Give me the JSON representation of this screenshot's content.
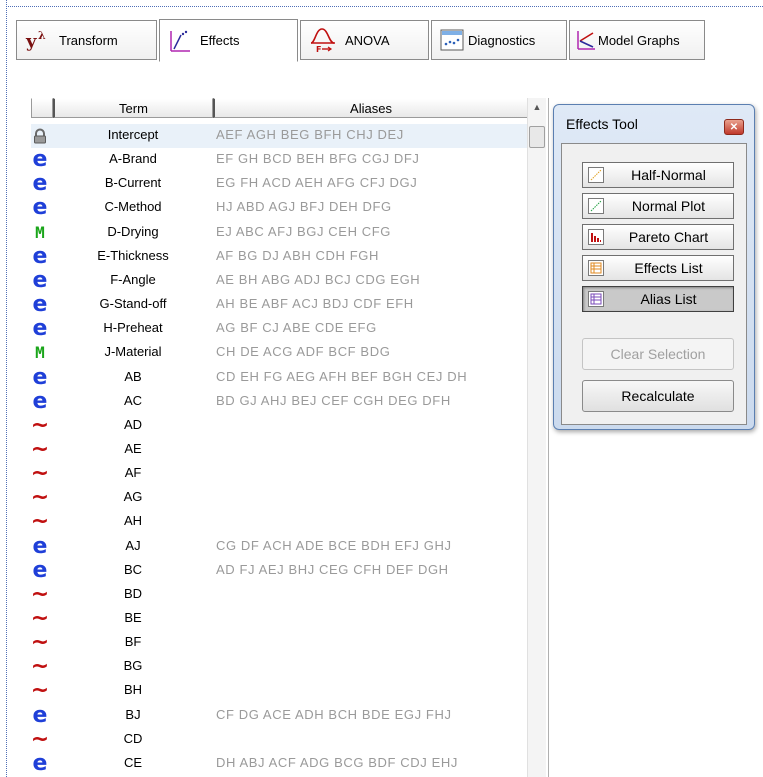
{
  "tabs": [
    {
      "id": "transform",
      "label": "Transform",
      "icon": "transform-lambda-icon",
      "active": false
    },
    {
      "id": "effects",
      "label": "Effects",
      "icon": "effects-icon",
      "active": true
    },
    {
      "id": "anova",
      "label": "ANOVA",
      "icon": "anova-icon",
      "active": false
    },
    {
      "id": "diagnostics",
      "label": "Diagnostics",
      "icon": "diagnostics-icon",
      "active": false
    },
    {
      "id": "model_graphs",
      "label": "Model Graphs",
      "icon": "model-graphs-icon",
      "active": false
    }
  ],
  "table": {
    "headers": {
      "term": "Term",
      "aliases": "Aliases"
    },
    "rows": [
      {
        "icon": "lock",
        "term": "Intercept",
        "aliases": "AEF AGH BEG BFH CHJ DEJ"
      },
      {
        "icon": "e",
        "term": "A-Brand",
        "aliases": "EF GH BCD BEH BFG CGJ DFJ"
      },
      {
        "icon": "e",
        "term": "B-Current",
        "aliases": "EG FH ACD AEH AFG CFJ DGJ"
      },
      {
        "icon": "e",
        "term": "C-Method",
        "aliases": "HJ ABD AGJ BFJ DEH DFG"
      },
      {
        "icon": "m",
        "term": "D-Drying",
        "aliases": "EJ ABC AFJ BGJ CEH CFG"
      },
      {
        "icon": "e",
        "term": "E-Thickness",
        "aliases": "AF BG DJ ABH CDH FGH"
      },
      {
        "icon": "e",
        "term": "F-Angle",
        "aliases": "AE BH ABG ADJ BCJ CDG EGH"
      },
      {
        "icon": "e",
        "term": "G-Stand-off",
        "aliases": "AH BE ABF ACJ BDJ CDF EFH"
      },
      {
        "icon": "e",
        "term": "H-Preheat",
        "aliases": "AG BF CJ ABE CDE EFG"
      },
      {
        "icon": "m",
        "term": "J-Material",
        "aliases": "CH DE ACG ADF BCF BDG"
      },
      {
        "icon": "e",
        "term": "AB",
        "aliases": "CD EH FG AEG AFH BEF BGH CEJ DH"
      },
      {
        "icon": "e",
        "term": "AC",
        "aliases": "BD GJ AHJ BEJ CEF CGH DEG DFH"
      },
      {
        "icon": "tilde",
        "term": "AD",
        "aliases": ""
      },
      {
        "icon": "tilde",
        "term": "AE",
        "aliases": ""
      },
      {
        "icon": "tilde",
        "term": "AF",
        "aliases": ""
      },
      {
        "icon": "tilde",
        "term": "AG",
        "aliases": ""
      },
      {
        "icon": "tilde",
        "term": "AH",
        "aliases": ""
      },
      {
        "icon": "e",
        "term": "AJ",
        "aliases": "CG DF ACH ADE BCE BDH EFJ GHJ"
      },
      {
        "icon": "e",
        "term": "BC",
        "aliases": "AD FJ AEJ BHJ CEG CFH DEF DGH"
      },
      {
        "icon": "tilde",
        "term": "BD",
        "aliases": ""
      },
      {
        "icon": "tilde",
        "term": "BE",
        "aliases": ""
      },
      {
        "icon": "tilde",
        "term": "BF",
        "aliases": ""
      },
      {
        "icon": "tilde",
        "term": "BG",
        "aliases": ""
      },
      {
        "icon": "tilde",
        "term": "BH",
        "aliases": ""
      },
      {
        "icon": "e",
        "term": "BJ",
        "aliases": "CF DG ACE ADH BCH BDE EGJ FHJ"
      },
      {
        "icon": "tilde",
        "term": "CD",
        "aliases": ""
      },
      {
        "icon": "e",
        "term": "CE",
        "aliases": "DH ABJ ACF ADG BCG BDF CDJ EHJ"
      }
    ]
  },
  "effects_tool": {
    "title": "Effects Tool",
    "plot_buttons": [
      {
        "label": "Half-Normal",
        "icon": "half-normal-icon",
        "pressed": false
      },
      {
        "label": "Normal Plot",
        "icon": "normal-plot-icon",
        "pressed": false
      },
      {
        "label": "Pareto Chart",
        "icon": "pareto-chart-icon",
        "pressed": false
      },
      {
        "label": "Effects List",
        "icon": "effects-list-icon",
        "pressed": false
      },
      {
        "label": "Alias List",
        "icon": "alias-list-icon",
        "pressed": true
      }
    ],
    "clear_selection_label": "Clear Selection",
    "recalculate_label": "Recalculate"
  },
  "colors": {
    "model_e": "#1f3fd8",
    "model_m": "#1aa51a",
    "error_tilde": "#c01010",
    "alias_text": "#9a9a9a"
  }
}
